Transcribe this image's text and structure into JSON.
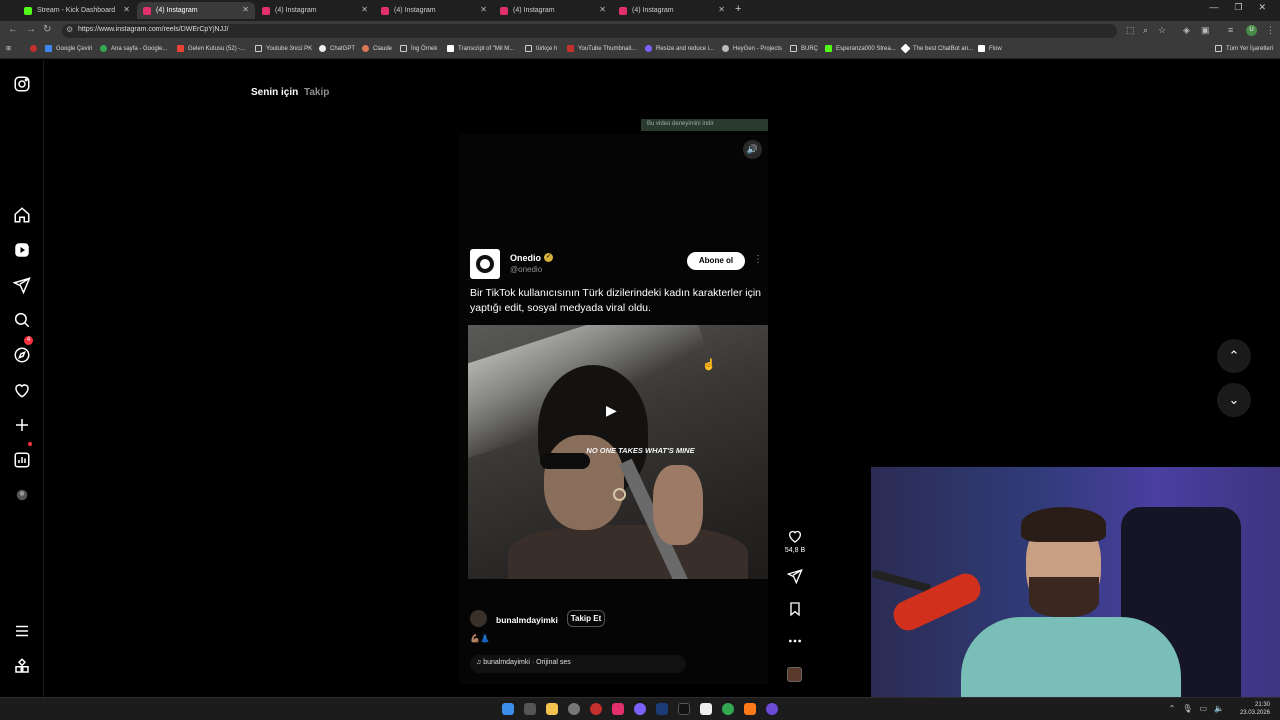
{
  "browser": {
    "tabs": [
      {
        "title": "Stream - Kick Dashboard",
        "color": "#53fc18"
      },
      {
        "title": "(4) Instagram",
        "color": "#e1306c"
      },
      {
        "title": "(4) Instagram",
        "color": "#e1306c"
      },
      {
        "title": "(4) Instagram",
        "color": "#e1306c"
      },
      {
        "title": "(4) Instagram",
        "color": "#e1306c"
      },
      {
        "title": "(4) Instagram",
        "color": "#e1306c"
      }
    ],
    "active_tab_index": 1,
    "url": "https://www.instagram.com/reels/DWErCpYjNJJ/",
    "bookmarks": [
      "Google Çeviri",
      "Ana sayfa - Google...",
      "Gelen Kutusu (52) -...",
      "Youtube 3ncü PK",
      "ChatGPT",
      "Claude",
      "İng Örnek",
      "Transcript of \"Mil M...",
      "türkçe h",
      "YouTube Thumbnail...",
      "Resize and reduce i...",
      "HeyGen - Projects",
      "BURÇ",
      "Esperanza000 Strea...",
      "The best ChatBot an...",
      "Flow",
      "Tüm Yer İşaretleri"
    ],
    "profile_initial": "U"
  },
  "instagram": {
    "feed_tabs": {
      "for_you": "Senin için",
      "following": "Takip"
    },
    "notification_count": "4",
    "ad_strip_text": "Bu video deneyimini indir",
    "post": {
      "account_name": "Onedio",
      "account_handle": "@onedio",
      "subscribe_label": "Abone ol",
      "caption": "Bir TikTok kullanıcısının Türk dizilerindeki kadın karakterler için yaptığı edit, sosyal medyada viral oldu.",
      "video_subtitle": "NO ONE TAKES WHAT'S MINE",
      "author": "bunalmdayimki",
      "follow_label": "Takip Et",
      "author_emoji": "💪🏽👗",
      "audio": "bunalmdayimki · Orijinal ses",
      "like_count": "54,8 B"
    }
  },
  "taskbar": {
    "time": "21:30",
    "date": "23.03.2026"
  }
}
